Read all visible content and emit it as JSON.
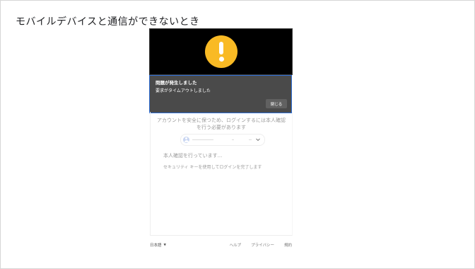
{
  "page": {
    "title": "モバイルデバイスと通信ができないとき"
  },
  "dialog": {
    "title": "問題が発生しました",
    "message": "要求がタイムアウトしました",
    "close_label": "閉じる",
    "icon": "warning-icon",
    "accent_color": "#f9ba24",
    "highlight_border": "#2f6fd6"
  },
  "signin": {
    "description": "アカウントを安全に保つため、ログインするには本人確認を行う必要があります",
    "account_icon": "avatar",
    "verifying_text": "本人確認を行っています...",
    "instruction_text": "セキュリティ キーを使用してログインを完了します"
  },
  "footer": {
    "language": "日本語",
    "links": [
      "ヘルプ",
      "プライバシー",
      "規約"
    ]
  }
}
